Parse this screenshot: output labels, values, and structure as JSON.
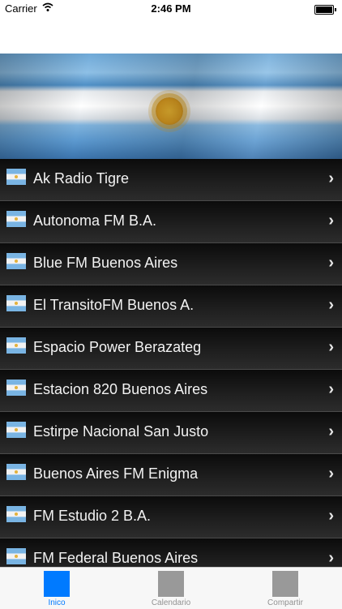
{
  "status_bar": {
    "carrier": "Carrier",
    "time": "2:46 PM"
  },
  "list": {
    "items": [
      {
        "label": "Ak Radio Tigre"
      },
      {
        "label": "Autonoma FM B.A."
      },
      {
        "label": "Blue FM Buenos Aires"
      },
      {
        "label": "El TransitoFM Buenos A."
      },
      {
        "label": "Espacio Power Berazateg"
      },
      {
        "label": "Estacion 820 Buenos Aires"
      },
      {
        "label": "Estirpe Nacional San Justo"
      },
      {
        "label": "Buenos Aires FM Enigma"
      },
      {
        "label": "FM Estudio 2 B.A."
      },
      {
        "label": "FM Federal Buenos Aires"
      }
    ],
    "chevron": "›"
  },
  "tabbar": {
    "tabs": [
      {
        "label": "Inico",
        "active": true
      },
      {
        "label": "Calendario",
        "active": false
      },
      {
        "label": "Compartir",
        "active": false
      }
    ]
  }
}
